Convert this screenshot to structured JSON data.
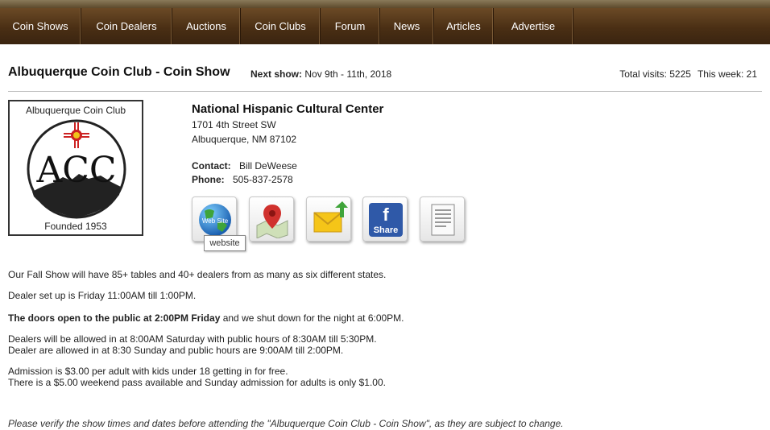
{
  "nav": [
    {
      "label": "Coin Shows"
    },
    {
      "label": "Coin Dealers"
    },
    {
      "label": "Auctions"
    },
    {
      "label": "Coin Clubs"
    },
    {
      "label": "Forum"
    },
    {
      "label": "News"
    },
    {
      "label": "Articles"
    },
    {
      "label": "Advertise"
    }
  ],
  "show": {
    "title": "Albuquerque Coin Club - Coin Show",
    "next_label": "Next show:",
    "next_dates": "Nov 9th - 11th, 2018",
    "total_visits": "Total visits: 5225",
    "this_week": "This week: 21"
  },
  "logo": {
    "top_text": "Albuquerque Coin Club",
    "initials": "ACC",
    "bottom_text": "Founded 1953"
  },
  "venue": {
    "name": "National Hispanic Cultural Center",
    "address1": "1701 4th Street SW",
    "address2": "Albuquerque, NM 87102",
    "contact_label": "Contact:",
    "contact_value": "Bill DeWeese",
    "phone_label": "Phone:",
    "phone_value": "505-837-2578"
  },
  "actions": {
    "website_text": "Web Site",
    "share_text": "Share",
    "tooltip": "website"
  },
  "icons": [
    "globe-icon",
    "map-pin-icon",
    "email-icon",
    "facebook-icon",
    "document-icon"
  ],
  "description": {
    "p1": "Our Fall Show will have 85+ tables and 40+ dealers from as many as six different states.",
    "p2": "Dealer set up is Friday 11:00AM till 1:00PM.",
    "p3_bold": "The doors open to the public at 2:00PM Friday",
    "p3_rest": " and we shut down for the night at 6:00PM.",
    "p4_line1": "Dealers will be allowed in at 8:00AM Saturday with public hours of 8:30AM till 5:30PM.",
    "p4_line2": "Dealer are allowed in at 8:30 Sunday and public hours are 9:00AM till 2:00PM.",
    "p5_line1": "Admission is $3.00 per adult with kids under 18 getting in for free.",
    "p5_line2": "There is a $5.00 weekend pass available and Sunday admission for adults is only $1.00.",
    "note": "Please verify the show times and dates before attending the \"Albuquerque Coin Club - Coin Show\", as they are subject to change."
  },
  "colors": {
    "nav_bg": "#4a2f14",
    "nav_text": "#ffffff",
    "accent_red": "#cc2222",
    "facebook_blue": "#2f59a8"
  }
}
